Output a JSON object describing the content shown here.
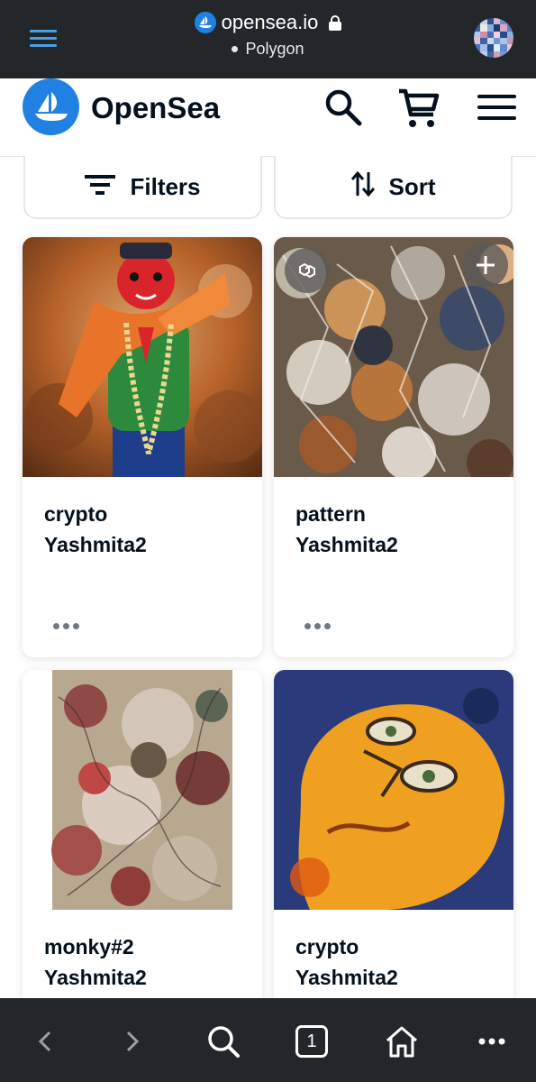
{
  "browser": {
    "url": "opensea.io",
    "network": "Polygon"
  },
  "header": {
    "brand": "OpenSea"
  },
  "toolbar": {
    "filters_label": "Filters",
    "sort_label": "Sort"
  },
  "cards": [
    {
      "title": "crypto",
      "creator": "Yashmita2"
    },
    {
      "title": "pattern",
      "creator": "Yashmita2"
    },
    {
      "title": "monky#2",
      "creator": "Yashmita2"
    },
    {
      "title": "crypto",
      "creator": "Yashmita2"
    }
  ],
  "bottom_nav": {
    "tab_count": "1"
  },
  "colors": {
    "brand_blue": "#2081e2",
    "browser_chrome": "#23272a",
    "text_primary": "#04111d"
  },
  "icons": [
    "menu-icon",
    "opensea-site-icon",
    "lock-icon",
    "search-icon",
    "cart-icon",
    "hamburger-icon",
    "filter-icon",
    "sort-icon",
    "polygon-chain-icon",
    "add-icon",
    "more-icon",
    "back-icon",
    "forward-icon",
    "tabs-icon",
    "home-icon"
  ]
}
